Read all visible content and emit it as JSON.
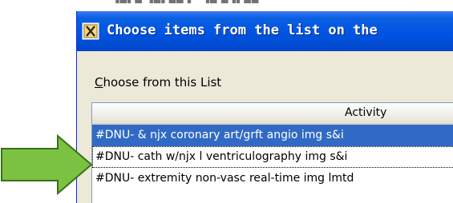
{
  "window": {
    "title": "Choose items from the list on the",
    "list_label_access": "C",
    "list_label_rest": "hoose from this List"
  },
  "list": {
    "column_header": "Activity",
    "rows": [
      {
        "text": "#DNU- & njx coronary art/grft angio img s&i",
        "selected": true
      },
      {
        "text": "#DNU- cath w/njx l ventriculography img s&i",
        "selected": false
      },
      {
        "text": "#DNU- extremity non-vasc real-time img lmtd",
        "selected": false
      }
    ]
  },
  "colors": {
    "titlebar": "#0054e3",
    "selection": "#316ac5",
    "arrow_fill": "#7cc242",
    "arrow_stroke": "#3a6e1c"
  },
  "icons": [
    "window-app-icon",
    "green-arrow-icon"
  ]
}
